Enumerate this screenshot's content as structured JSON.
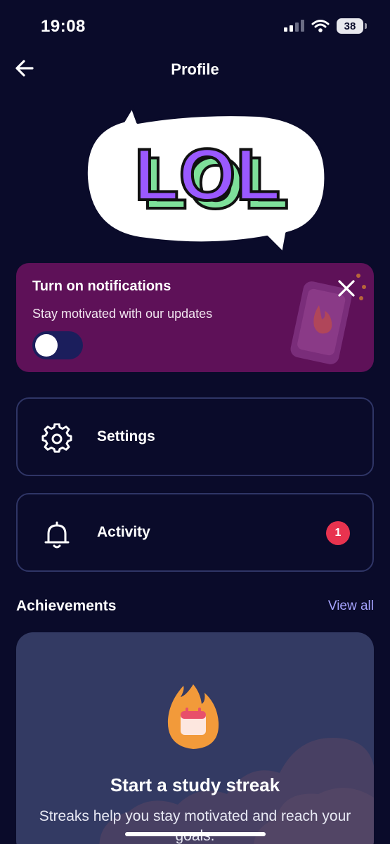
{
  "status_bar": {
    "time": "19:08",
    "battery": "38",
    "icons": [
      "signal-icon",
      "wifi-icon",
      "battery-icon"
    ]
  },
  "header": {
    "title": "Profile",
    "back_icon": "arrow-left-icon"
  },
  "hero": {
    "sticker_text": "LOL"
  },
  "notification_card": {
    "title": "Turn on notifications",
    "subtitle": "Stay motivated with our updates",
    "toggle_on": false,
    "close_icon": "close-icon",
    "background": "#5e1158"
  },
  "menu": {
    "items": [
      {
        "label": "Settings",
        "icon": "gear-icon"
      },
      {
        "label": "Activity",
        "icon": "bell-icon",
        "badge": "1"
      }
    ]
  },
  "achievements": {
    "title": "Achievements",
    "view_all": "View all",
    "card": {
      "icon": "fire-calendar-icon",
      "title": "Start a study streak",
      "description": "Streaks help you stay motivated and reach your goals."
    }
  },
  "colors": {
    "background": "#0a0b2a",
    "accent_link": "#a6a4ff",
    "badge": "#e8334f",
    "toggle_track": "#1b1e5c"
  }
}
